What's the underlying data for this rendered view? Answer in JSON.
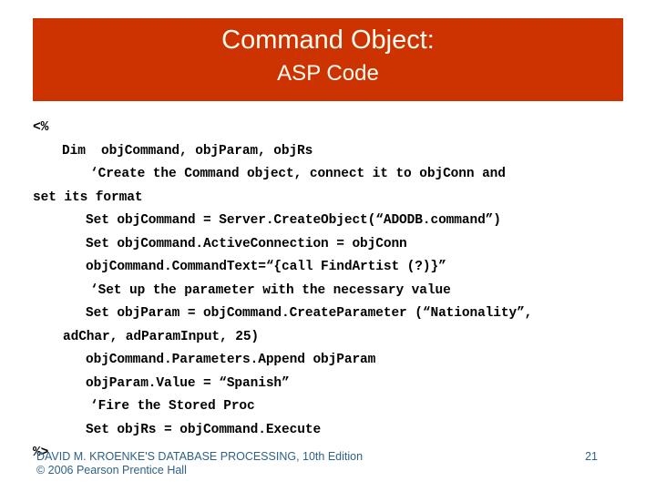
{
  "slide": {
    "title": "Command Object:",
    "subtitle": "ASP Code",
    "banner_color": "#cd3301",
    "title_color": "#fffdf2",
    "footer_color": "#2e6188"
  },
  "code": {
    "lines": [
      {
        "indent": "ind-0",
        "text": "<%"
      },
      {
        "indent": "ind-1",
        "text": "Dim  objCommand, objParam, objRs"
      },
      {
        "indent": "ind-2",
        "text": "‘Create the Command object, connect it to objConn and"
      },
      {
        "indent": "ind- wrap",
        "text": "set its format"
      },
      {
        "indent": "ind-2b",
        "text": "Set objCommand = Server.CreateObject(“ADODB.command”)"
      },
      {
        "indent": "ind-2b",
        "text": "Set objCommand.ActiveConnection = objConn"
      },
      {
        "indent": "ind-2b",
        "text": "objCommand.CommandText=“{call FindArtist (?)}”"
      },
      {
        "indent": "ind-2",
        "text": "‘Set up the parameter with the necessary value"
      },
      {
        "indent": "ind-2b",
        "text": "Set objParam = objCommand.CreateParameter (“Nationality”,"
      },
      {
        "indent": "ind-wrap",
        "text": "adChar, adParamInput, 25)"
      },
      {
        "indent": "ind-2b",
        "text": "objCommand.Parameters.Append objParam"
      },
      {
        "indent": "ind-2b",
        "text": "objParam.Value = “Spanish”"
      },
      {
        "indent": "ind-2",
        "text": "‘Fire the Stored Proc"
      },
      {
        "indent": "ind-2b",
        "text": "Set objRs = objCommand.Execute"
      },
      {
        "indent": "ind-0",
        "text": "%>"
      }
    ]
  },
  "footer": {
    "credit_line_1": "DAVID M. KROENKE'S DATABASE PROCESSING, 10th Edition",
    "credit_line_2": "© 2006 Pearson Prentice Hall",
    "page_number": "21"
  }
}
